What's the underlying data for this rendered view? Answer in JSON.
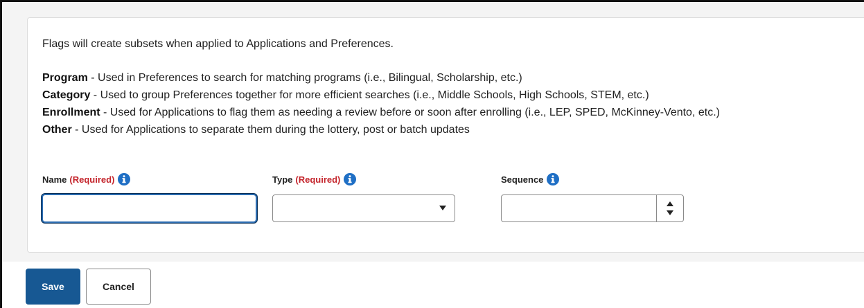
{
  "intro": "Flags will create subsets when applied to Applications and Preferences.",
  "definitions": [
    {
      "term": "Program",
      "text": " - Used in Preferences to search for matching programs (i.e., Bilingual, Scholarship, etc.)"
    },
    {
      "term": "Category",
      "text": " - Used to group Preferences together for more efficient searches (i.e., Middle Schools, High Schools, STEM, etc.)"
    },
    {
      "term": "Enrollment",
      "text": " - Used for Applications to flag them as needing a review before or soon after enrolling (i.e., LEP, SPED, McKinney-Vento, etc.)"
    },
    {
      "term": "Other",
      "text": " - Used for Applications to separate them during the lottery, post or batch updates"
    }
  ],
  "fields": {
    "name": {
      "label": "Name",
      "required": "(Required)",
      "value": ""
    },
    "type": {
      "label": "Type",
      "required": "(Required)",
      "value": ""
    },
    "sequence": {
      "label": "Sequence",
      "value": ""
    }
  },
  "buttons": {
    "save": "Save",
    "cancel": "Cancel"
  },
  "icons": {
    "info": "info-icon",
    "dropdown": "caret-down-icon",
    "spin_up": "caret-up-icon",
    "spin_down": "caret-down-icon"
  },
  "colors": {
    "primary": "#175893",
    "required": "#c4242b",
    "info_icon": "#1f6fc5",
    "focus_border": "#2a6bb0"
  }
}
